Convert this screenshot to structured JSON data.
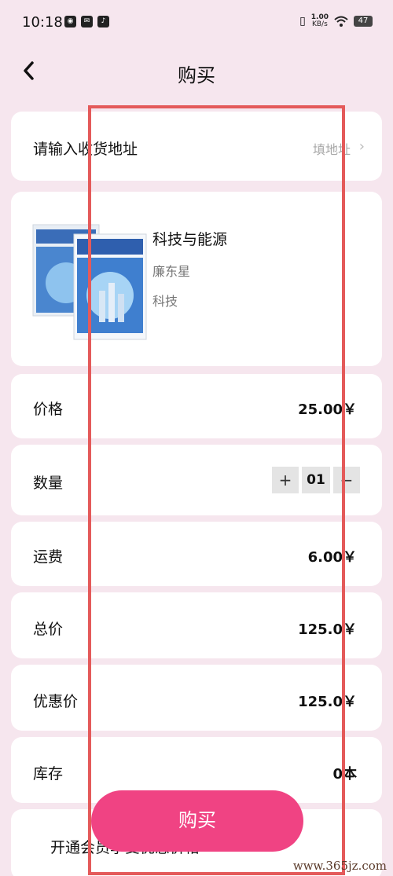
{
  "status_bar": {
    "time": "10:18",
    "net_speed_value": "1.00",
    "net_speed_unit": "KB/s",
    "battery": "47"
  },
  "nav": {
    "title": "购买"
  },
  "address": {
    "label": "请输入收货地址",
    "hint": "填地址"
  },
  "product": {
    "title": "科技与能源",
    "author": "廉东星",
    "category": "科技"
  },
  "rows": {
    "price_label": "价格",
    "price_value": "25.00￥",
    "quantity_label": "数量",
    "quantity_value": "01",
    "shipping_label": "运费",
    "shipping_value": "6.00￥",
    "total_label": "总价",
    "total_value": "125.0￥",
    "discount_label": "优惠价",
    "discount_value": "125.0￥",
    "stock_label": "库存",
    "stock_value": "0本"
  },
  "vip": {
    "text": "开通会员享受优惠价格"
  },
  "buy_button": {
    "label": "购买"
  },
  "watermark": "www.365jz.com",
  "colors": {
    "accent": "#f04383",
    "background": "#f6e6ee",
    "highlight": "#e45a5a"
  }
}
